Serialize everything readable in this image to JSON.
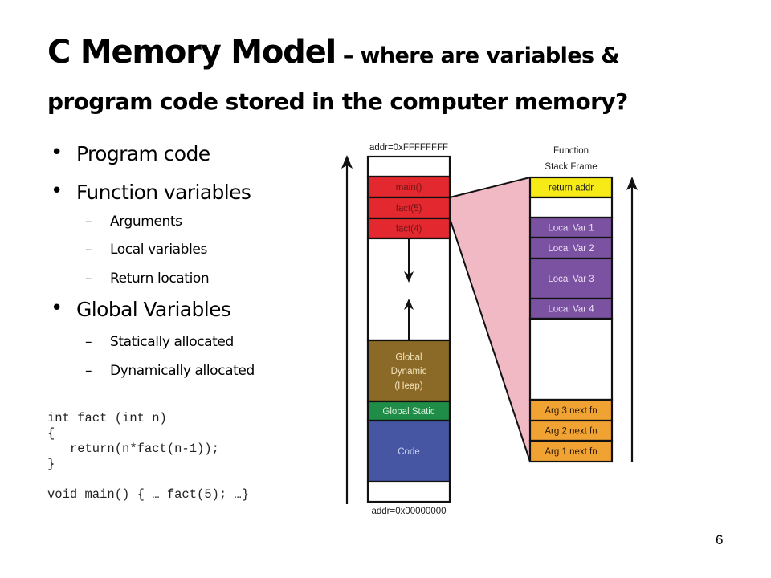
{
  "slide": {
    "title_main": "C Memory Model",
    "title_rest_line1": " – where are variables &",
    "title_line2": "program code stored in the computer memory?",
    "page_number": "6"
  },
  "bullets": [
    {
      "text": "Program code",
      "level": 1
    },
    {
      "text": "Function variables",
      "level": 1
    },
    {
      "text": "Arguments",
      "level": 2
    },
    {
      "text": "Local variables",
      "level": 2
    },
    {
      "text": "Return location",
      "level": 2
    },
    {
      "text": "Global Variables",
      "level": 1
    },
    {
      "text": "Statically allocated",
      "level": 2
    },
    {
      "text": "Dynamically allocated",
      "level": 2
    }
  ],
  "bullet_glyph": "•",
  "dash_glyph": "–",
  "code_lines": [
    "int fact (int n)",
    "{",
    "   return(n*fact(n-1));",
    "}",
    "",
    "void main() { … fact(5); …}"
  ],
  "diagram": {
    "addr_top": "addr=0xFFFFFFFF",
    "addr_bottom": "addr=0x00000000",
    "frame_title_line1": "Function",
    "frame_title_line2": "Stack Frame",
    "memory_segments": [
      {
        "label": "",
        "color": "#ffffff",
        "text_color": "#000000"
      },
      {
        "label": "main()",
        "color": "#e3282f",
        "text_color": "#6e1515"
      },
      {
        "label": "fact(5)",
        "color": "#e3282f",
        "text_color": "#6e1515"
      },
      {
        "label": "fact(4)",
        "color": "#e3282f",
        "text_color": "#6e1515"
      },
      {
        "label": "",
        "color": "#ffffff",
        "text_color": "#000000"
      },
      {
        "label": "Global|Dynamic|(Heap)",
        "color": "#8b6a28",
        "text_color": "#f3e3b8"
      },
      {
        "label": "Global Static",
        "color": "#1f8c48",
        "text_color": "#d8f0dc"
      },
      {
        "label": "Code",
        "color": "#4656a3",
        "text_color": "#c9d0f0"
      },
      {
        "label": "",
        "color": "#ffffff",
        "text_color": "#000000"
      }
    ],
    "frame_segments": [
      {
        "label": "return addr",
        "color": "#f6ea17",
        "text_color": "#222222"
      },
      {
        "label": "",
        "color": "#ffffff",
        "text_color": "#000000"
      },
      {
        "label": "Local Var 1",
        "color": "#7b52a1",
        "text_color": "#ecdff5"
      },
      {
        "label": "Local Var 2",
        "color": "#7b52a1",
        "text_color": "#ecdff5"
      },
      {
        "label": "Local Var 3",
        "color": "#7b52a1",
        "text_color": "#ecdff5"
      },
      {
        "label": "Local Var 4",
        "color": "#7b52a1",
        "text_color": "#ecdff5"
      },
      {
        "label": "",
        "color": "#ffffff",
        "text_color": "#000000"
      },
      {
        "label": "Arg 3 next fn",
        "color": "#f0a232",
        "text_color": "#2a1a05"
      },
      {
        "label": "Arg 2 next fn",
        "color": "#f0a232",
        "text_color": "#2a1a05"
      },
      {
        "label": "Arg 1 next fn",
        "color": "#f0a232",
        "text_color": "#2a1a05"
      }
    ],
    "zoom_wedge_color": "#f0b9c4"
  }
}
